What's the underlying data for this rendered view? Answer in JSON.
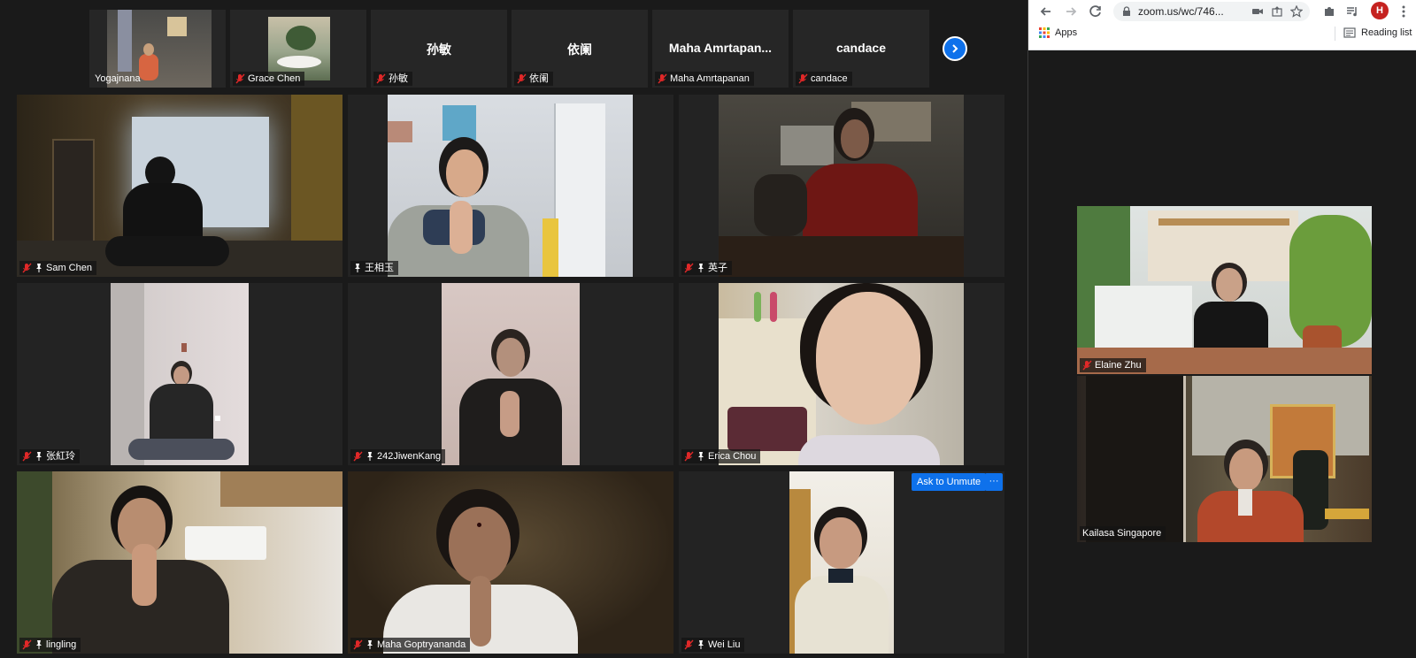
{
  "strip": {
    "tiles": [
      {
        "name": "Yogajnana",
        "initials": ""
      },
      {
        "name": "Grace Chen",
        "initials": ""
      },
      {
        "name": "孙敏",
        "initials": "孙敏"
      },
      {
        "name": "依阑",
        "initials": "依阑"
      },
      {
        "name": "Maha Amrtapanan",
        "initials": "Maha Amrtapan..."
      },
      {
        "name": "candace",
        "initials": "candace"
      }
    ]
  },
  "grid": {
    "tiles": [
      {
        "name": "Sam Chen"
      },
      {
        "name": "王相玉"
      },
      {
        "name": "英子"
      },
      {
        "name": "张紅玲"
      },
      {
        "name": "242JiwenKang"
      },
      {
        "name": "Erica Chou"
      },
      {
        "name": "lingling"
      },
      {
        "name": "Maha Goptryananda"
      },
      {
        "name": "Wei Liu"
      }
    ]
  },
  "controls": {
    "ask_to_unmute": "Ask to Unmute",
    "more": "···"
  },
  "browser": {
    "url": "zoom.us/wc/746...",
    "profile_initial": "H",
    "bookmarks": {
      "apps": "Apps",
      "reading_list": "Reading list"
    }
  },
  "right_tiles": [
    {
      "name": "Elaine Zhu"
    },
    {
      "name": "Kailasa Singapore"
    }
  ],
  "colors": {
    "background": "#1a1a1a",
    "tile": "#232323",
    "accent": "#0e71eb",
    "muted_red": "#e02828"
  }
}
